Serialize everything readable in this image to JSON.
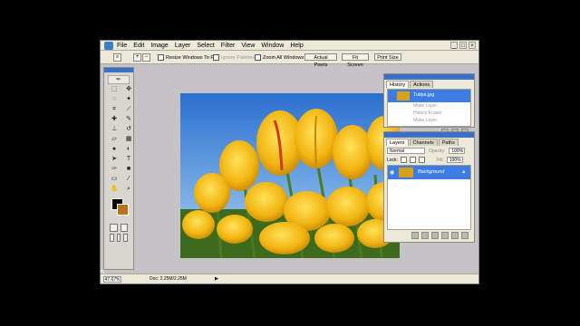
{
  "menubar": {
    "items": [
      "File",
      "Edit",
      "Image",
      "Layer",
      "Select",
      "Filter",
      "View",
      "Window",
      "Help"
    ],
    "window_controls": [
      "_",
      "□",
      "×"
    ]
  },
  "options_bar": {
    "resize_windows": "Resize Windows To Fit",
    "ignore_palettes": "Ignore Palettes",
    "zoom_all_windows": "Zoom All Windows",
    "actual_pixels": "Actual Pixels",
    "fit_screen": "Fit Screen",
    "print_size": "Print Size"
  },
  "status_bar": {
    "zoom": "47.67%",
    "doc_info": "Doc: 2.25M/2.25M"
  },
  "history_panel": {
    "tabs": [
      "History",
      "Actions"
    ],
    "snapshot": "Tulips.jpg",
    "states": [
      "Make Layer",
      "History Eraser",
      "Make Layer"
    ]
  },
  "layers_panel": {
    "tabs": [
      "Layers",
      "Channels",
      "Paths"
    ],
    "blend_mode": "Normal",
    "opacity_label": "Opacity:",
    "opacity_value": "100%",
    "lock_label": "Lock:",
    "fill_label": "Fill:",
    "fill_value": "100%",
    "layer_name": "Background"
  },
  "colors": {
    "foreground": "#000000",
    "background": "#b5761c",
    "accent": "#3d7de3"
  },
  "icons": [
    "zoom-tool-icon",
    "move-tool-icon",
    "marquee-tool-icon",
    "lasso-tool-icon",
    "magic-wand-icon",
    "crop-tool-icon",
    "slice-tool-icon",
    "brush-tool-icon",
    "stamp-tool-icon",
    "eraser-tool-icon",
    "gradient-tool-icon",
    "blur-tool-icon",
    "dodge-tool-icon",
    "path-select-icon",
    "type-tool-icon",
    "pen-tool-icon",
    "shape-tool-icon",
    "notes-tool-icon",
    "eyedropper-icon",
    "hand-tool-icon",
    "eye-icon",
    "lock-icon"
  ]
}
